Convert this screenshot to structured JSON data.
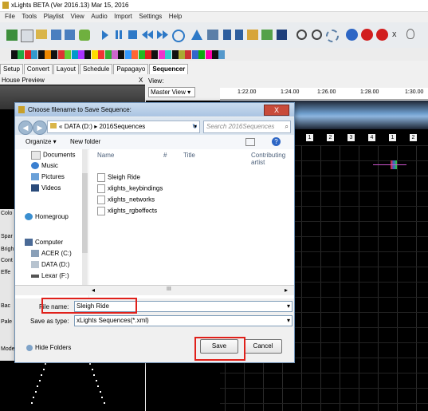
{
  "window": {
    "title": "xLights BETA (Ver 2016.13) Mar 15, 2016"
  },
  "menu": [
    "File",
    "Tools",
    "Playlist",
    "View",
    "Audio",
    "Import",
    "Settings",
    "Help"
  ],
  "tabs": [
    "Setup",
    "Convert",
    "Layout",
    "Schedule",
    "Papagayo",
    "Sequencer"
  ],
  "house_preview": {
    "title": "House Preview",
    "close": "X"
  },
  "sequencer": {
    "view_label": "View:",
    "view_value": "Master View",
    "timeline": [
      "1:22.00",
      "1:24.00",
      "1:26.00",
      "1:28.00",
      "1:30.00"
    ],
    "timing_marks": [
      "1",
      "2",
      "3",
      "4",
      "1",
      "2",
      "3",
      "4",
      "1",
      "2"
    ]
  },
  "left_fragments": [
    "Colo",
    "Spar",
    "Brigh",
    "Cont",
    "Effe",
    "Bac",
    "Pale",
    "Mode"
  ],
  "dialog": {
    "title": "Choose filename to Save Sequence:",
    "close": "X",
    "path": [
      "«",
      "DATA (D:)",
      "▸",
      "2016Sequences"
    ],
    "search_placeholder": "Search 2016Sequences",
    "organize": "Organize ▾",
    "new_folder": "New folder",
    "nav_items": [
      "Documents",
      "Music",
      "Pictures",
      "Videos",
      "Homegroup",
      "Computer",
      "ACER (C:)",
      "DATA (D:)",
      "Lexar (F:)"
    ],
    "columns": [
      "Name",
      "#",
      "Title",
      "Contributing artist"
    ],
    "files": [
      "Sleigh Ride",
      "xlights_keybindings",
      "xlights_networks",
      "xlights_rgbeffects"
    ],
    "file_name_label": "File name:",
    "file_name_value": "Sleigh Ride",
    "save_type_label": "Save as type:",
    "save_type_value": "xLights Sequences(*.xml)",
    "hide_folders": "Hide Folders",
    "save_button": "Save",
    "cancel_button": "Cancel",
    "scroll_mark": "III"
  },
  "colors": {
    "highlight": "#e0201a",
    "dialog_border": "#6d8fb3"
  }
}
